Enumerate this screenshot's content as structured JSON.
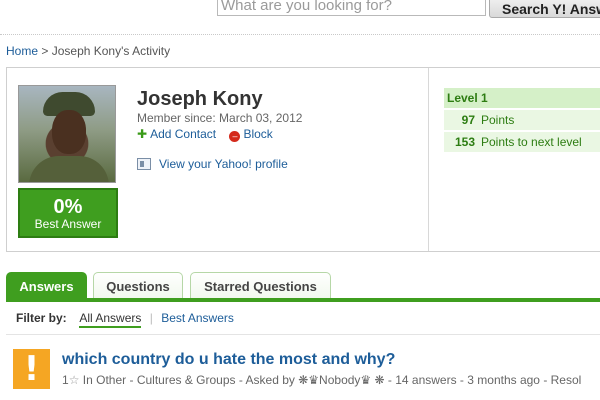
{
  "search": {
    "placeholder": "What are you looking for?",
    "button_label": "Search Y! Answ"
  },
  "breadcrumb": {
    "home": "Home",
    "separator": ">",
    "current": "Joseph Kony's Activity"
  },
  "profile": {
    "name": "Joseph Kony",
    "member_since": "Member since: March 03, 2012",
    "add_contact": "Add Contact",
    "block": "Block",
    "view_profile": "View your Yahoo! profile",
    "best_answer_pct": "0%",
    "best_answer_label": "Best Answer"
  },
  "level": {
    "title": "Level 1",
    "points_value": "97",
    "points_label": "Points",
    "next_value": "153",
    "next_label": "Points to next level"
  },
  "tabs": [
    {
      "label": "Answers",
      "active": true
    },
    {
      "label": "Questions",
      "active": false
    },
    {
      "label": "Starred Questions",
      "active": false
    }
  ],
  "filter": {
    "label": "Filter by:",
    "options": [
      "All Answers",
      "Best Answers"
    ],
    "selected": "All Answers"
  },
  "question": {
    "title": "which country do u hate the most and why?",
    "stars": "1",
    "category_prefix": "In Other - Cultures & Groups",
    "asked_by": "- Asked by ❋♛Nobody♛ ❋",
    "answers": "- 14 answers - 3 months ago - Resol"
  },
  "colors": {
    "brand_green": "#3f9e1f",
    "link_blue": "#1d5d99",
    "question_icon": "#f5a623",
    "block_red": "#d42a1c"
  }
}
